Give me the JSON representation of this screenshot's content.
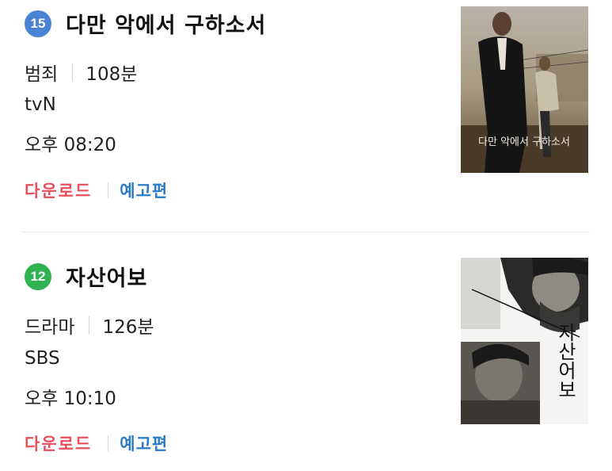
{
  "colors": {
    "rating_15": "#4a82d4",
    "rating_12": "#2fb350",
    "download": "#e8505b",
    "trailer": "#2a7cc7"
  },
  "items": [
    {
      "rating": "15",
      "title": "다만 악에서 구하소서",
      "genre": "범죄",
      "duration": "108분",
      "channel": "tvN",
      "airtime": "오후 08:20",
      "download_label": "다운로드",
      "trailer_label": "예고편",
      "poster_text": "다만 악에서 구하소서"
    },
    {
      "rating": "12",
      "title": "자산어보",
      "genre": "드라마",
      "duration": "126분",
      "channel": "SBS",
      "airtime": "오후 10:10",
      "download_label": "다운로드",
      "trailer_label": "예고편",
      "poster_text": "자산어보"
    }
  ]
}
